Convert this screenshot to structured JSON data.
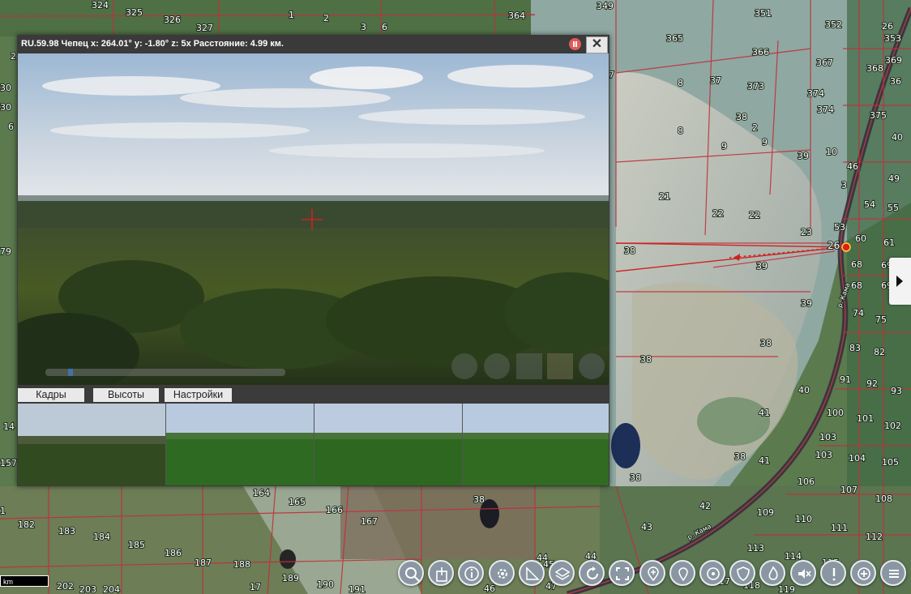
{
  "camera": {
    "title": "RU.59.98 Чепец x: 264.01° y: -1.80° z: 5x Расстояние: 4.99 км.",
    "close_label": "✕",
    "tabs": [
      "Кадры",
      "Высоты",
      "Настройки"
    ]
  },
  "map": {
    "scale_label": "km",
    "site_label": "26",
    "river_label": "р. Кама",
    "parcels": [
      {
        "t": "324"
      },
      {
        "t": "325"
      },
      {
        "t": "326"
      },
      {
        "t": "327"
      },
      {
        "t": "1"
      },
      {
        "t": "2"
      },
      {
        "t": "3"
      },
      {
        "t": "6"
      },
      {
        "t": "364"
      },
      {
        "t": "349"
      },
      {
        "t": "351"
      },
      {
        "t": "352"
      },
      {
        "t": "26"
      },
      {
        "t": "353"
      },
      {
        "t": "365"
      },
      {
        "t": "366"
      },
      {
        "t": "367"
      },
      {
        "t": "368"
      },
      {
        "t": "369"
      },
      {
        "t": "36"
      },
      {
        "t": "37"
      },
      {
        "t": "373"
      },
      {
        "t": "374"
      },
      {
        "t": "374"
      },
      {
        "t": "375"
      },
      {
        "t": "8"
      },
      {
        "t": "8"
      },
      {
        "t": "38"
      },
      {
        "t": "2"
      },
      {
        "t": "9"
      },
      {
        "t": "9"
      },
      {
        "t": "39"
      },
      {
        "t": "10"
      },
      {
        "t": "46"
      },
      {
        "t": "49"
      },
      {
        "t": "40"
      },
      {
        "t": "3"
      },
      {
        "t": "21"
      },
      {
        "t": "22"
      },
      {
        "t": "22"
      },
      {
        "t": "54"
      },
      {
        "t": "55"
      },
      {
        "t": "53"
      },
      {
        "t": "23"
      },
      {
        "t": "60"
      },
      {
        "t": "61"
      },
      {
        "t": "38"
      },
      {
        "t": "39"
      },
      {
        "t": "68"
      },
      {
        "t": "69"
      },
      {
        "t": "68"
      },
      {
        "t": "69"
      },
      {
        "t": "39"
      },
      {
        "t": "74"
      },
      {
        "t": "75"
      },
      {
        "t": "38"
      },
      {
        "t": "83"
      },
      {
        "t": "82"
      },
      {
        "t": "38"
      },
      {
        "t": "91"
      },
      {
        "t": "92"
      },
      {
        "t": "93"
      },
      {
        "t": "40"
      },
      {
        "t": "41"
      },
      {
        "t": "100"
      },
      {
        "t": "101"
      },
      {
        "t": "102"
      },
      {
        "t": "103"
      },
      {
        "t": "38"
      },
      {
        "t": "41"
      },
      {
        "t": "103"
      },
      {
        "t": "104"
      },
      {
        "t": "105"
      },
      {
        "t": "38"
      },
      {
        "t": "106"
      },
      {
        "t": "107"
      },
      {
        "t": "108"
      },
      {
        "t": "42"
      },
      {
        "t": "109"
      },
      {
        "t": "110"
      },
      {
        "t": "111"
      },
      {
        "t": "43"
      },
      {
        "t": "112"
      },
      {
        "t": "113"
      },
      {
        "t": "114"
      },
      {
        "t": "115"
      },
      {
        "t": "116"
      },
      {
        "t": "164"
      },
      {
        "t": "165"
      },
      {
        "t": "166"
      },
      {
        "t": "167"
      },
      {
        "t": "38"
      },
      {
        "t": "182"
      },
      {
        "t": "183"
      },
      {
        "t": "184"
      },
      {
        "t": "185"
      },
      {
        "t": "186"
      },
      {
        "t": "187"
      },
      {
        "t": "188"
      },
      {
        "t": "189"
      },
      {
        "t": "190"
      },
      {
        "t": "191"
      },
      {
        "t": "202"
      },
      {
        "t": "203"
      },
      {
        "t": "204"
      },
      {
        "t": "17"
      },
      {
        "t": "44"
      },
      {
        "t": "44"
      },
      {
        "t": "45"
      },
      {
        "t": "46"
      },
      {
        "t": "47"
      },
      {
        "t": "117"
      },
      {
        "t": "118"
      },
      {
        "t": "119"
      },
      {
        "t": "30"
      },
      {
        "t": "30"
      },
      {
        "t": "79"
      },
      {
        "t": "14"
      },
      {
        "t": "157"
      },
      {
        "t": "1"
      },
      {
        "t": "2"
      },
      {
        "t": "6"
      },
      {
        "t": "7"
      }
    ]
  },
  "toolbar": {
    "buttons": [
      {
        "icon": "search-icon"
      },
      {
        "icon": "export-icon"
      },
      {
        "icon": "info-icon"
      },
      {
        "icon": "gear-icon"
      },
      {
        "icon": "ruler-icon"
      },
      {
        "icon": "layers-icon"
      },
      {
        "icon": "refresh-icon"
      },
      {
        "icon": "fullscreen-icon"
      },
      {
        "icon": "pin-add-icon"
      },
      {
        "icon": "pin-icon"
      },
      {
        "icon": "target-icon"
      },
      {
        "icon": "shield-icon"
      },
      {
        "icon": "fire-icon"
      },
      {
        "icon": "mute-icon"
      },
      {
        "icon": "alert-icon"
      },
      {
        "icon": "zoom-in-icon"
      },
      {
        "icon": "menu-icon"
      }
    ]
  }
}
